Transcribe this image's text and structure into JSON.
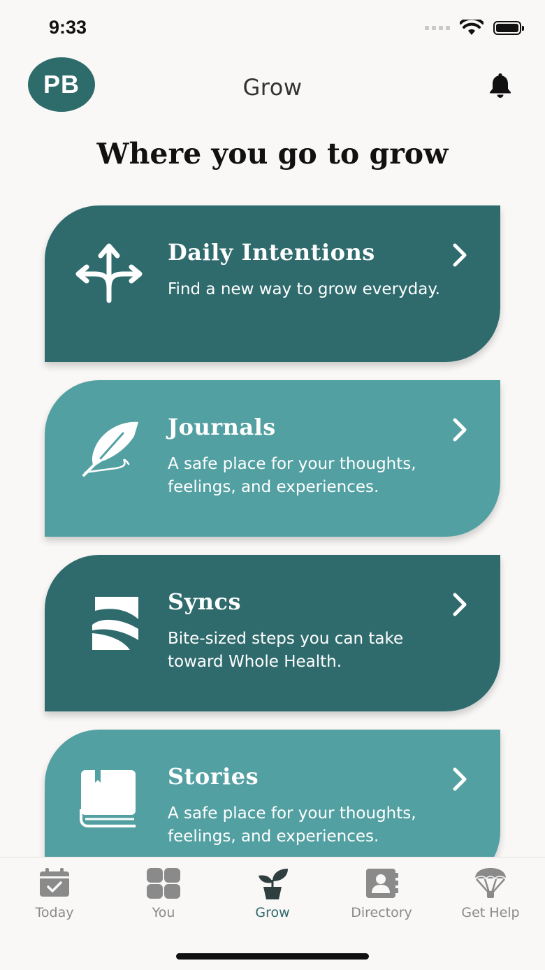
{
  "status_bar": {
    "time": "9:33"
  },
  "header": {
    "avatar_initials": "PB",
    "title": "Grow"
  },
  "headline": "Where you go to grow",
  "cards": [
    {
      "title": "Daily Intentions",
      "description": "Find a new way to grow everyday.",
      "icon": "branching-arrows-icon",
      "style": "dark"
    },
    {
      "title": "Journals",
      "description": "A safe place for your thoughts, feelings, and experiences.",
      "icon": "feather-icon",
      "style": "light"
    },
    {
      "title": "Syncs",
      "description": "Bite-sized steps you can take toward Whole Health.",
      "icon": "syncs-logo-icon",
      "style": "dark"
    },
    {
      "title": "Stories",
      "description": "A safe place for your thoughts, feelings, and experiences.",
      "icon": "book-icon",
      "style": "light"
    }
  ],
  "tabs": [
    {
      "label": "Today",
      "icon": "calendar-check-icon",
      "active": false
    },
    {
      "label": "You",
      "icon": "grid-icon",
      "active": false
    },
    {
      "label": "Grow",
      "icon": "plant-icon",
      "active": true
    },
    {
      "label": "Directory",
      "icon": "contact-book-icon",
      "active": false
    },
    {
      "label": "Get Help",
      "icon": "parachute-icon",
      "active": false
    }
  ],
  "colors": {
    "dark_teal": "#2f6b6d",
    "light_teal": "#53a0a2",
    "inactive_tab": "#8a8a8a",
    "background": "#faf8f6"
  }
}
